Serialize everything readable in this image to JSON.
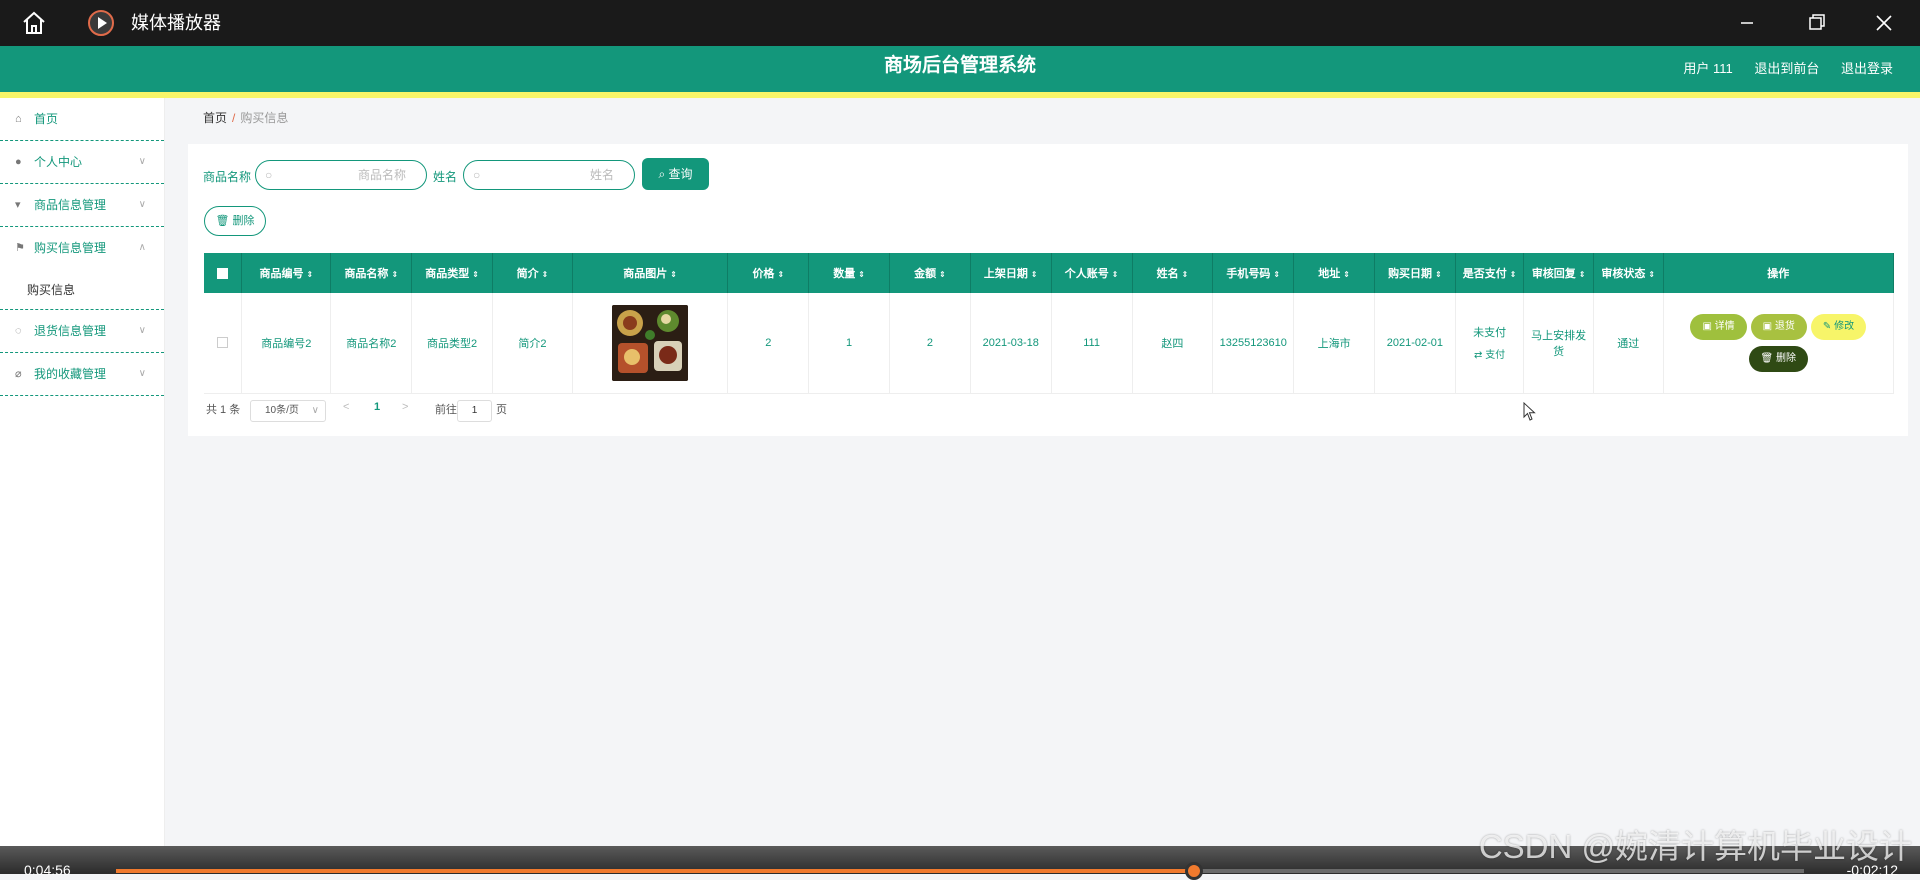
{
  "player": {
    "title": "媒体播放器",
    "current_time": "0:04:56",
    "remaining_time": "-0:02:12",
    "progress": 0.6385,
    "watermark": "CSDN @婉清计算机毕业设计"
  },
  "app": {
    "title": "商场后台管理系统",
    "user_label": "用户 111",
    "front_link": "退出到前台",
    "logout_link": "退出登录"
  },
  "colors": {
    "primary": "#13977b",
    "accent_yellow": "#f7f569",
    "dark_green": "#2f4a14"
  },
  "sidebar": {
    "items": [
      {
        "label": "首页",
        "icon": "home-icon",
        "expandable": false
      },
      {
        "label": "个人中心",
        "icon": "user-icon",
        "expandable": true
      },
      {
        "label": "商品信息管理",
        "icon": "goods-icon",
        "expandable": true
      },
      {
        "label": "购买信息管理",
        "icon": "flag-icon",
        "expandable": true,
        "expanded": true,
        "children": [
          "购买信息"
        ]
      },
      {
        "label": "退货信息管理",
        "icon": "return-icon",
        "expandable": true
      },
      {
        "label": "我的收藏管理",
        "icon": "favorite-icon",
        "expandable": true
      }
    ]
  },
  "breadcrumb": {
    "home": "首页",
    "separator": "/",
    "current": "购买信息"
  },
  "search": {
    "product_label": "商品名称",
    "product_placeholder": "商品名称",
    "name_label": "姓名",
    "name_placeholder": "姓名",
    "query_button": "查询",
    "delete_button": "删除"
  },
  "table": {
    "columns": [
      "商品编号",
      "商品名称",
      "商品类型",
      "简介",
      "商品图片",
      "价格",
      "数量",
      "金额",
      "上架日期",
      "个人账号",
      "姓名",
      "手机号码",
      "地址",
      "购买日期",
      "是否支付",
      "审核回复",
      "审核状态",
      "操作"
    ],
    "rows": [
      {
        "product_no": "商品编号2",
        "product_name": "商品名称2",
        "product_type": "商品类型2",
        "intro": "简介2",
        "image": "food-photo",
        "price": "2",
        "quantity": "1",
        "amount": "2",
        "shelf_date": "2021-03-18",
        "account": "111",
        "name": "赵四",
        "phone": "13255123610",
        "address": "上海市",
        "purchase_date": "2021-02-01",
        "paid": "未支付",
        "pay_action": "支付",
        "review_reply": "马上安排发货",
        "review_status": "通过",
        "actions": {
          "detail": "详情",
          "return": "退货",
          "edit": "修改",
          "delete": "删除"
        }
      }
    ]
  },
  "pagination": {
    "total": "共 1 条",
    "page_size": "10条/页",
    "current_page": "1",
    "goto_label": "前往",
    "goto_value": "1",
    "page_unit": "页"
  }
}
